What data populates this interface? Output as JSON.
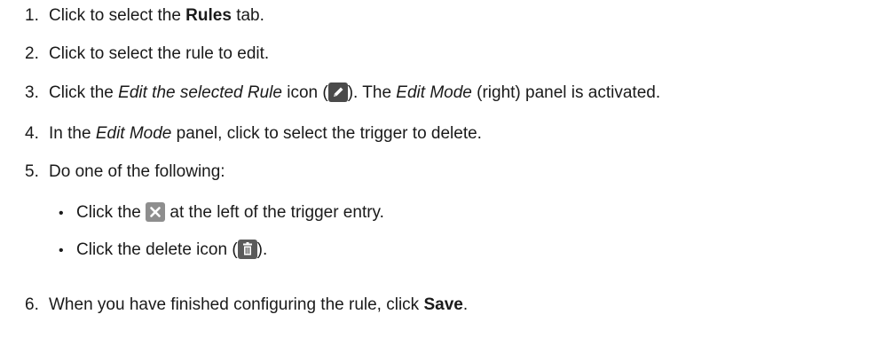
{
  "steps": [
    {
      "num": "1.",
      "pre": "Click to select the ",
      "bold": "Rules",
      "post": " tab."
    },
    {
      "num": "2.",
      "text": "Click to select the rule to edit."
    },
    {
      "num": "3.",
      "pre": "Click the ",
      "italic": "Edit the selected Rule",
      "mid": " icon (",
      "post": "). The ",
      "italic2": "Edit Mode",
      "post2": " (right) panel is activated."
    },
    {
      "num": "4.",
      "pre": "In the ",
      "italic": "Edit Mode",
      "post": " panel, click to select the trigger to delete."
    },
    {
      "num": "5.",
      "text": "Do one of the following:"
    },
    {
      "num": "6.",
      "pre": "When you have finished configuring the rule, click ",
      "bold": "Save",
      "post": "."
    }
  ],
  "substeps": [
    {
      "bullet": "•",
      "pre": "Click the ",
      "post": " at the left of the trigger entry."
    },
    {
      "bullet": "•",
      "pre": "Click the delete icon (",
      "post": ")."
    }
  ],
  "icons": {
    "edit": "pencil-icon",
    "remove": "close-icon",
    "delete": "trash-icon"
  }
}
